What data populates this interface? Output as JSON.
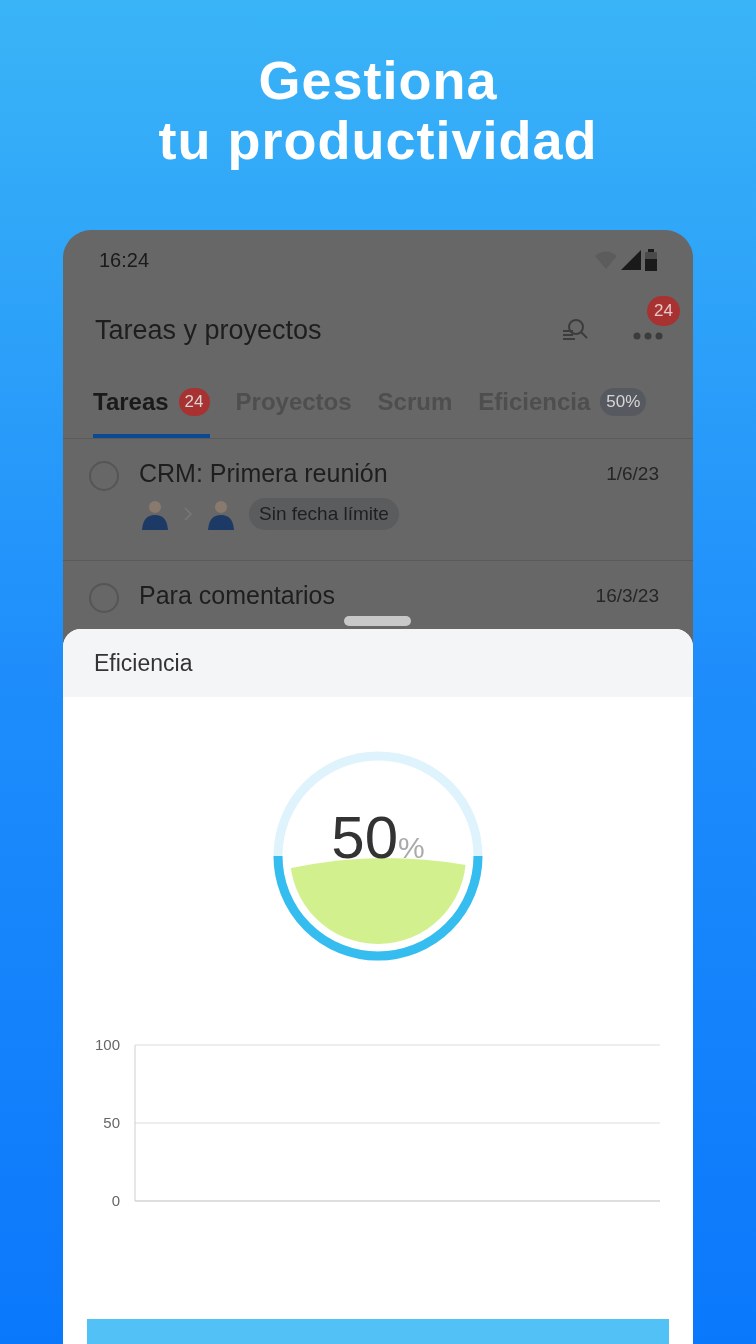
{
  "headline": [
    "Gestiona",
    "tu productividad"
  ],
  "status_bar": {
    "time": "16:24"
  },
  "app_bar": {
    "title": "Tareas y proyectos",
    "more_badge": "24"
  },
  "tabs": [
    {
      "label": "Tareas",
      "selected": true,
      "badge": {
        "text": "24",
        "color": "#a83232"
      }
    },
    {
      "label": "Proyectos",
      "selected": false
    },
    {
      "label": "Scrum",
      "selected": false
    },
    {
      "label": "Eficiencia",
      "selected": false,
      "badge": {
        "text": "50%",
        "color": "#565a60"
      }
    }
  ],
  "tasks": [
    {
      "title": "CRM: Primera reunión",
      "date": "1/6/23",
      "checked": false,
      "tag": "Sin fecha límite"
    },
    {
      "title": "Para comentarios",
      "date": "16/3/23",
      "checked": false
    }
  ],
  "sheet": {
    "title": "Eficiencia",
    "gauge": {
      "value": "50",
      "unit": "%"
    },
    "chart": {
      "y_labels": [
        "100",
        "50",
        "0"
      ]
    }
  }
}
